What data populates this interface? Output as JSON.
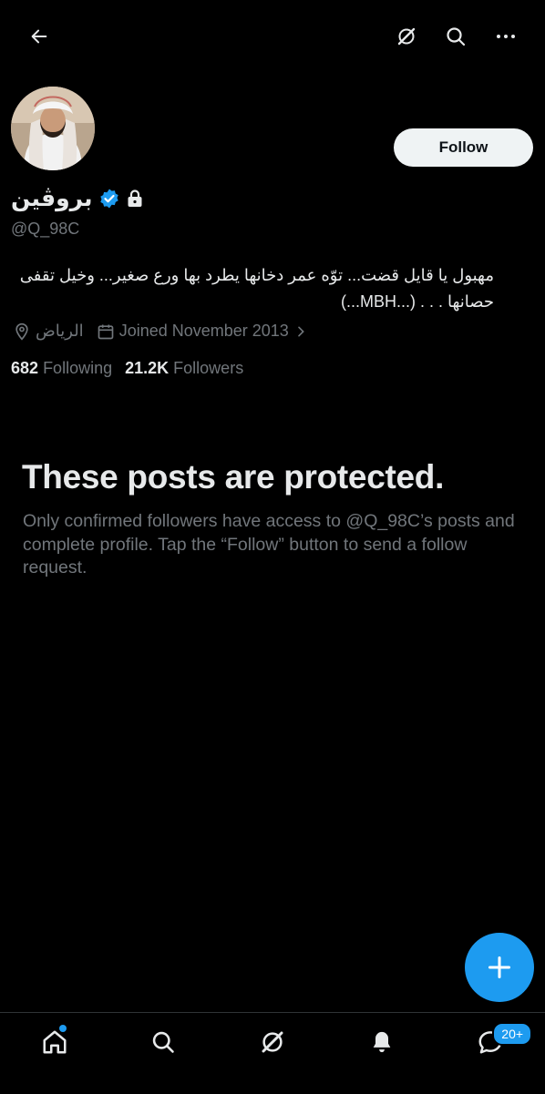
{
  "header": {
    "back_icon": "arrow-left-icon",
    "grok_icon": "grok-icon",
    "search_icon": "search-icon",
    "more_icon": "more-horizontal-icon"
  },
  "profile": {
    "display_name": "بروڤين",
    "handle": "@Q_98C",
    "verified_color": "#1d9bf0",
    "bio": "مهبول يا قايل قضت... توّه عمر دخانها يطرد بها ورع صغير... وخيل تقفى حصانها . . . (...MBH...)",
    "location": "الرياض",
    "joined": "Joined November 2013",
    "following_count": "682",
    "following_label": "Following",
    "followers_count": "21.2K",
    "followers_label": "Followers"
  },
  "follow_button": {
    "label": "Follow"
  },
  "protected": {
    "title": "These posts are protected.",
    "description": "Only confirmed followers have access to @Q_98C’s posts and complete profile. Tap the “Follow” button to send a follow request."
  },
  "bottom_nav": {
    "items": [
      "home-icon",
      "search-icon",
      "grok-icon",
      "notifications-icon",
      "messages-icon"
    ],
    "messages_badge": "20+"
  },
  "colors": {
    "background": "#000000",
    "accent": "#1d9bf0",
    "muted": "#71767b",
    "text": "#e7e9ea"
  }
}
